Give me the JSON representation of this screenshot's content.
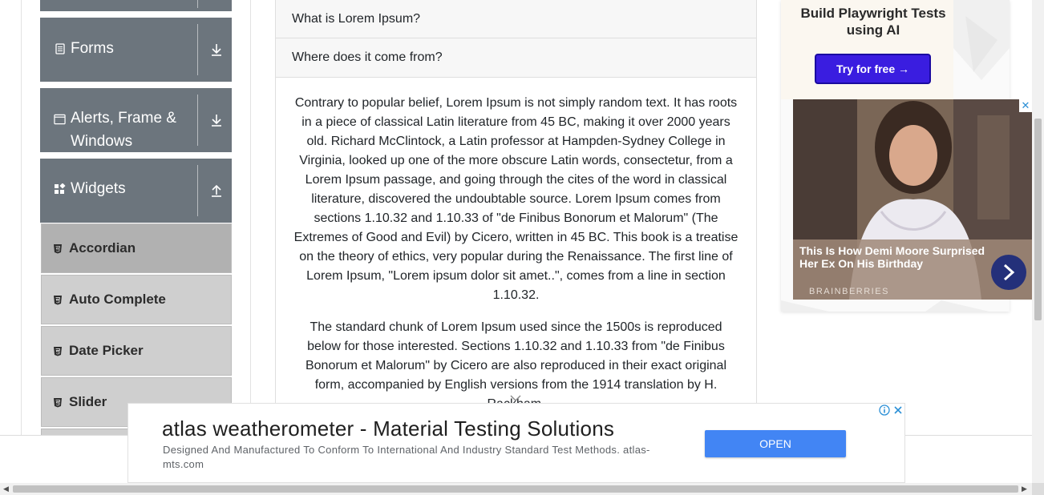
{
  "sidebar": {
    "groups": [
      {
        "label": "Forms",
        "icon": "form-icon",
        "toggle": "download-arrow-icon"
      },
      {
        "label": "Alerts, Frame &",
        "label_line2": "Windows",
        "icon": "window-icon",
        "toggle": "download-arrow-icon"
      },
      {
        "label": "Widgets",
        "icon": "widgets-icon",
        "toggle": "upload-arrow-icon"
      }
    ],
    "items": [
      {
        "label": "Accordian",
        "active": true
      },
      {
        "label": "Auto Complete"
      },
      {
        "label": "Date Picker"
      },
      {
        "label": "Slider"
      }
    ]
  },
  "accordion": {
    "sections": [
      {
        "title": "What is Lorem Ipsum?"
      },
      {
        "title": "Where does it come from?"
      }
    ],
    "body": [
      "Contrary to popular belief, Lorem Ipsum is not simply random text. It has roots in a piece of classical Latin literature from 45 BC, making it over 2000 years old. Richard McClintock, a Latin professor at Hampden-Sydney College in Virginia, looked up one of the more obscure Latin words, consectetur, from a Lorem Ipsum passage, and going through the cites of the word in classical literature, discovered the undoubtable source. Lorem Ipsum comes from sections 1.10.32 and 1.10.33 of \"de Finibus Bonorum et Malorum\" (The Extremes of Good and Evil) by Cicero, written in 45 BC. This book is a treatise on the theory of ethics, very popular during the Renaissance. The first line of Lorem Ipsum, \"Lorem ipsum dolor sit amet..\", comes from a line in section 1.10.32.",
      "The standard chunk of Lorem Ipsum used since the 1500s is reproduced below for those interested. Sections 1.10.32 and 1.10.33 from \"de Finibus Bonorum et Malorum\" by Cicero are also reproduced in their exact original form, accompanied by English versions from the 1914 translation by H. Rackham."
    ]
  },
  "ads": {
    "playwright": {
      "title": "Build Playwright Tests using AI",
      "button": "Try for free →",
      "button_color": "#3a1de0"
    },
    "photo": {
      "caption": "This Is How Demi Moore Surprised Her Ex On His Birthday",
      "brand": "BRAINBERRIES",
      "close": "✕"
    },
    "banner": {
      "title": "atlas weatherometer - Material Testing Solutions",
      "description": "Designed And Manufactured To Conform To International And Industry Standard Test Methods. atlas-mts.com",
      "button": "OPEN",
      "button_color": "#4285f4"
    }
  }
}
